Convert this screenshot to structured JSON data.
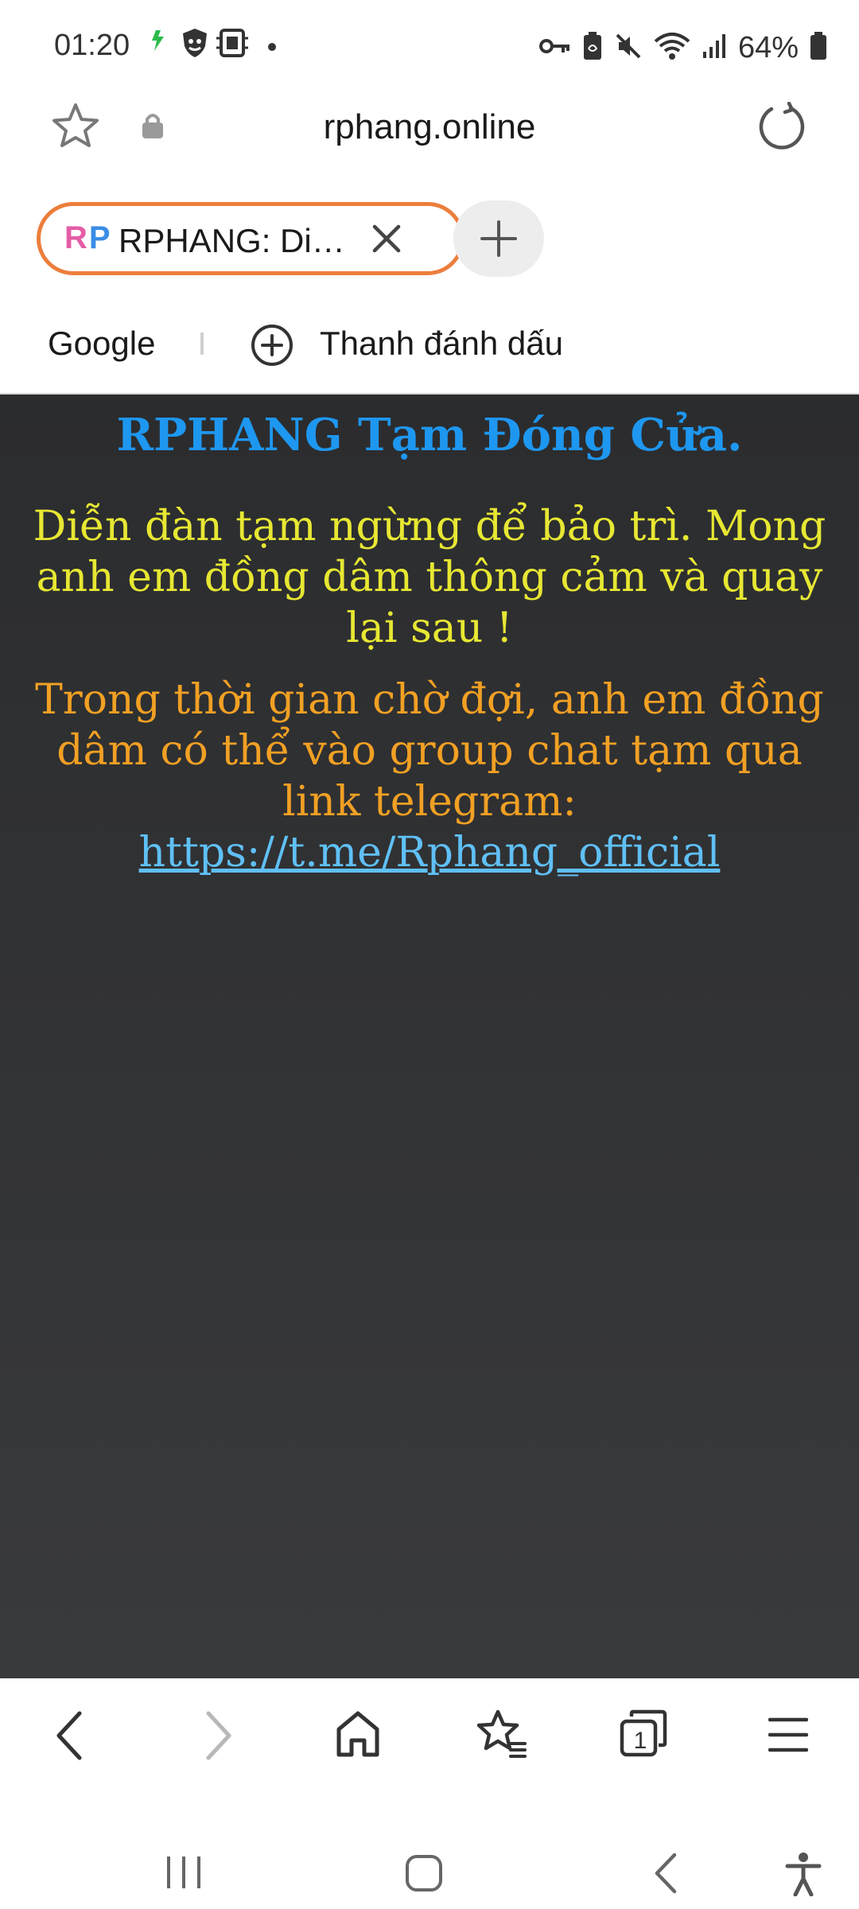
{
  "status_bar": {
    "time": "01:20",
    "battery_percent": "64%",
    "left_icons": [
      "app-notification-icon",
      "shield-icon",
      "sim-icon",
      "dot-icon"
    ],
    "right_icons": [
      "vpn-key-icon",
      "battery-saver-icon",
      "mute-icon",
      "wifi-icon",
      "signal-icon",
      "battery-icon"
    ]
  },
  "url_bar": {
    "url": "rphang.online"
  },
  "tabs": [
    {
      "favicon_text_1": "R",
      "favicon_text_2": "P",
      "title": "RPHANG: Di…",
      "active": true
    }
  ],
  "bookmarks_bar": {
    "items": [
      "Google"
    ],
    "add_label": "Thanh đánh dấu"
  },
  "page": {
    "title": "RPHANG Tạm Đóng Cửa.",
    "message": "Diễn đàn tạm ngừng để bảo trì. Mong anh em đồng dâm thông cảm và quay lại sau !",
    "hint_prefix": "Trong thời gian chờ đợi, anh em đồng dâm có thể vào group chat tạm qua link telegram: ",
    "link_text": "https://t.me/Rphang_official",
    "colors": {
      "title": "#1e97f0",
      "message": "#e7e733",
      "hint": "#f1a024",
      "link": "#5fc0f6",
      "background": "#2b2c2e"
    }
  },
  "toolbar": {
    "tab_count": "1",
    "buttons": [
      "back-icon",
      "forward-icon",
      "home-icon",
      "bookmarks-icon",
      "tabs-icon",
      "menu-icon"
    ]
  },
  "nav_bar": {
    "buttons": [
      "recents-icon",
      "home-circle-icon",
      "back-icon",
      "accessibility-icon"
    ]
  }
}
